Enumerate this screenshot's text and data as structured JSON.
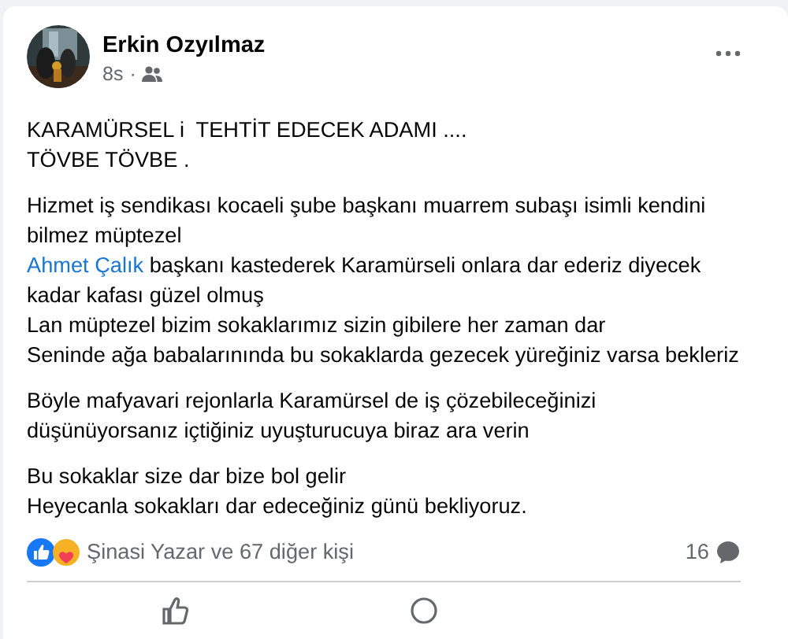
{
  "post": {
    "author": "Erkin Ozyılmaz",
    "time": "8s",
    "separator": "·",
    "paragraphs": [
      {
        "lines": [
          {
            "text": "KARAMÜRSEL i  TEHTİT EDECEK ADAMI ...."
          },
          {
            "text": "TÖVBE TÖVBE ."
          }
        ]
      },
      {
        "lines": [
          {
            "text": "Hizmet iş sendikası kocaeli şube başkanı muarrem subaşı isimli kendini bilmez müptezel"
          },
          {
            "link": "Ahmet Çalık",
            "text": " başkanı kastederek Karamürseli onlara dar ederiz diyecek kadar kafası güzel olmuş"
          },
          {
            "text": "Lan müptezel bizim sokaklarımız sizin gibilere her zaman dar"
          },
          {
            "text": "Seninde ağa babalarınında bu sokaklarda gezecek yüreğiniz varsa bekleriz"
          }
        ]
      },
      {
        "lines": [
          {
            "text": "Böyle mafyavari rejonlarla Karamürsel de iş çözebileceğinizi düşünüyorsanız içtiğiniz uyuşturucuya biraz ara verin"
          }
        ]
      },
      {
        "lines": [
          {
            "text": "Bu sokaklar size dar bize bol gelir"
          },
          {
            "text": "Heyecanla sokakları dar edeceğiniz günü bekliyoruz."
          }
        ]
      }
    ],
    "reactions": {
      "summary": "Şinasi Yazar ve 67 diğer kişi",
      "comments": "16"
    }
  }
}
